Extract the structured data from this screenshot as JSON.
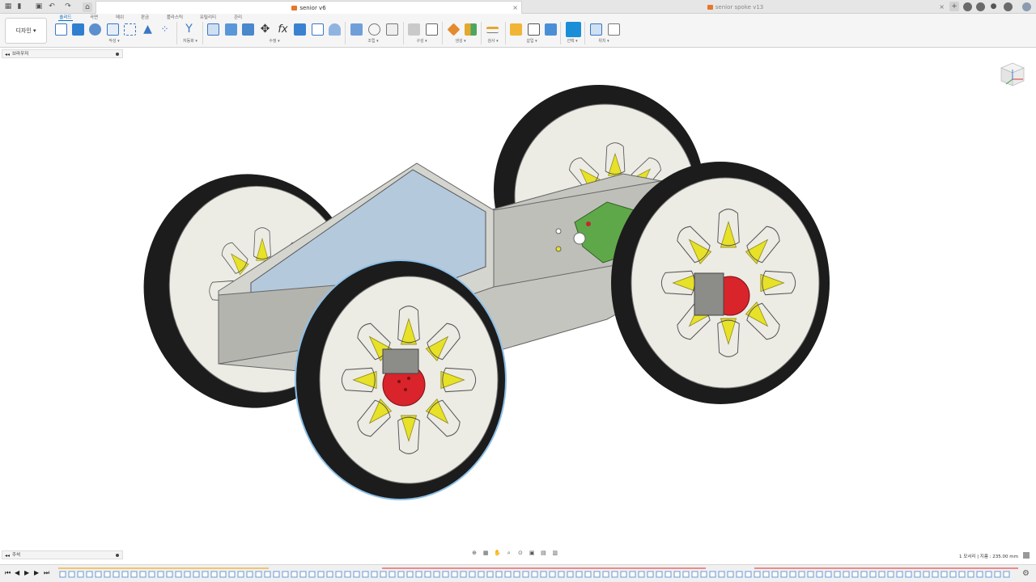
{
  "app": {
    "tabs": [
      {
        "title": "senior v6",
        "active": true
      },
      {
        "title": "senior spoke v13",
        "active": false
      }
    ]
  },
  "toolbar": {
    "workspace": "디자인",
    "tabs": [
      {
        "label": "솔리드",
        "active": true
      },
      {
        "label": "곡면",
        "active": false
      },
      {
        "label": "메쉬",
        "active": false
      },
      {
        "label": "판금",
        "active": false
      },
      {
        "label": "플라스틱",
        "active": false
      },
      {
        "label": "유틸리티",
        "active": false
      },
      {
        "label": "관리",
        "active": false
      }
    ],
    "groups": [
      {
        "label": "작성 ▾"
      },
      {
        "label": "자동화 ▾"
      },
      {
        "label": "수정 ▾"
      },
      {
        "label": "조립 ▾"
      },
      {
        "label": "구성 ▾"
      },
      {
        "label": "생성 ▾"
      },
      {
        "label": "검사 ▾"
      },
      {
        "label": "삽입 ▾"
      },
      {
        "label": "선택 ▾"
      },
      {
        "label": "위치 ▾"
      }
    ],
    "colors": {
      "accent": "#0a6dc2",
      "active_tool": "#1a8fd8"
    }
  },
  "browser": {
    "label": "브라우저"
  },
  "comments": {
    "label": "주석"
  },
  "status": {
    "text": "1 모서리 | 지름 : 235.00 mm"
  },
  "model": {
    "colors": {
      "tire": "#1c1c1c",
      "wheel": "#ecebe4",
      "spoke": "#e7e128",
      "hub": "#d8242a",
      "chassis": "#c5c5c0",
      "glass": "#a8c4e0",
      "board": "#5fa84a"
    }
  }
}
